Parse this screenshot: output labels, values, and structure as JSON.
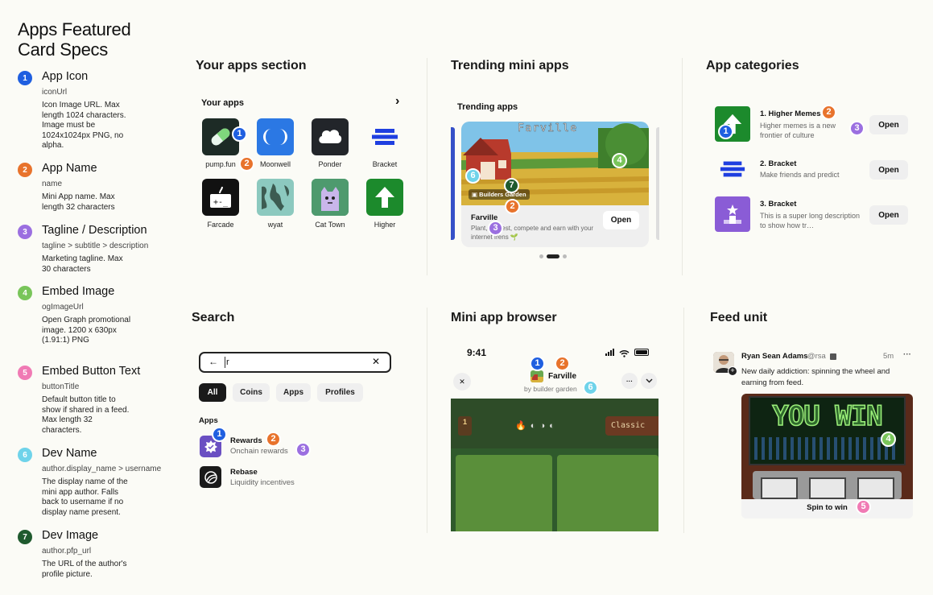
{
  "title": "Apps Featured\nCard Specs",
  "specs": [
    {
      "n": "1",
      "title": "App Icon",
      "key": "iconUrl",
      "desc": "Icon Image URL. Max\nlength 1024 characters.\nImage must be\n1024x1024px PNG, no\nalpha."
    },
    {
      "n": "2",
      "title": "App Name",
      "key": "name",
      "desc": "Mini App name. Max\nlength 32 characters"
    },
    {
      "n": "3",
      "title": "Tagline / Description",
      "key": "tagline > subtitle > description",
      "desc": "Marketing tagline. Max\n30 characters"
    },
    {
      "n": "4",
      "title": "Embed Image",
      "key": "ogImageUrl",
      "desc": "Open Graph promotional\nimage. 1200 x 630px\n(1.91:1) PNG"
    },
    {
      "n": "5",
      "title": "Embed Button Text",
      "key": "buttonTitle",
      "desc": "Default button title to\nshow if shared in a feed.\nMax length 32\ncharacters."
    },
    {
      "n": "6",
      "title": "Dev Name",
      "key": "author.display_name > username",
      "desc": "The display name of the\nmini app author. Falls\nback to username if no\ndisplay name present."
    },
    {
      "n": "7",
      "title": "Dev Image",
      "key": "author.pfp_url",
      "desc": "The URL of the author's\nprofile picture."
    }
  ],
  "sections": {
    "your_apps": "Your apps section",
    "trending": "Trending mini apps",
    "categories": "App categories",
    "search": "Search",
    "browser": "Mini app browser",
    "feed": "Feed unit"
  },
  "your_apps": {
    "header": "Your apps",
    "chevron": "›",
    "apps": [
      "pump.fun",
      "Moonwell",
      "Ponder",
      "Bracket",
      "Farcade",
      "wyat",
      "Cat Town",
      "Higher"
    ]
  },
  "trending": {
    "header": "Trending apps",
    "image_title": "Farville",
    "builder": "Builders Garden",
    "name": "Farville",
    "tagline": "Plant, harvest, compete and earn with your internet frens 🌱",
    "open": "Open"
  },
  "categories": {
    "items": [
      {
        "name": "1. Higher Memes",
        "desc": "Higher memes is a new frontier of culture",
        "open": "Open"
      },
      {
        "name": "2. Bracket",
        "desc": "Make friends and predict",
        "open": "Open"
      },
      {
        "name": "3. Bracket",
        "desc": "This is a super long description to show how tr…",
        "open": "Open"
      }
    ]
  },
  "search": {
    "query": "r",
    "back": "←",
    "clear": "✕",
    "chips": [
      "All",
      "Coins",
      "Apps",
      "Profiles"
    ],
    "apps_label": "Apps",
    "results": [
      {
        "name": "Rewards",
        "desc": "Onchain rewards"
      },
      {
        "name": "Rebase",
        "desc": "Liquidity incentives"
      }
    ]
  },
  "browser": {
    "time": "9:41",
    "app_name": "Farville",
    "author": "by builder garden",
    "close": "✕",
    "more": "···",
    "chevron": "⌄",
    "game_label": "Classic",
    "counter": "1"
  },
  "feed": {
    "user": "Ryan Sean Adams",
    "handle": "@rsa",
    "time": "5m",
    "more": "···",
    "text": "New daily addiction: spinning the wheel and earning from feed.",
    "banner": "YOU WIN",
    "button": "Spin to win"
  },
  "colors": {
    "blue": "#1f5fe0",
    "orange": "#e8732c",
    "purple": "#9b6fe0",
    "green": "#79c55a",
    "pink": "#f07ab4",
    "cyan": "#6fd3ea",
    "darkgreen": "#1f5a2e"
  }
}
